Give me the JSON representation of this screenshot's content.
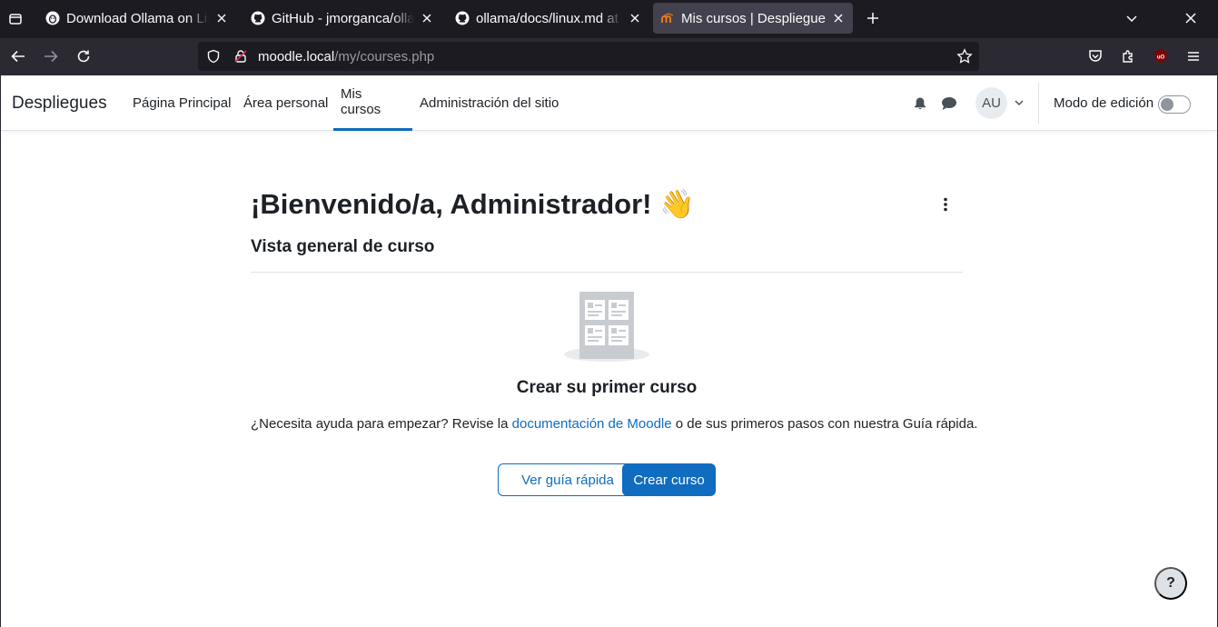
{
  "browser": {
    "tabs": [
      {
        "title": "Download Ollama on Linux",
        "icon": "ollama-icon",
        "active": false
      },
      {
        "title": "GitHub - jmorganca/ollama",
        "icon": "github-icon",
        "active": false
      },
      {
        "title": "ollama/docs/linux.md at main",
        "icon": "github-icon",
        "active": false
      },
      {
        "title": "Mis cursos | Despliegues",
        "icon": "moodle-icon",
        "active": true
      }
    ],
    "url": {
      "host": "moodle.local",
      "path": "/my/courses.php"
    }
  },
  "moodle": {
    "brand": "Despliegues",
    "nav": [
      {
        "label": "Página Principal"
      },
      {
        "label": "Área personal"
      },
      {
        "label": "Mis cursos",
        "active": true
      },
      {
        "label": "Administración del sitio"
      }
    ],
    "user_initials": "AU",
    "edit_mode_label": "Modo de edición",
    "edit_mode_on": false
  },
  "main": {
    "welcome": "¡Bienvenido/a, Administrador! 👋",
    "section_title": "Vista general de curso",
    "empty_title": "Crear su primer curso",
    "help_prefix": "¿Necesita ayuda para empezar? Revise la ",
    "help_link": "documentación de Moodle",
    "help_suffix": " o de sus primeros pasos con nuestra Guía rápida.",
    "btn_quick_guide": "Ver guía rápida",
    "btn_create_course": "Crear curso"
  },
  "help_button": "?",
  "colors": {
    "primary": "#0f6cbf",
    "browser_dark": "#1c1b22",
    "browser_toolbar": "#2b2a33"
  }
}
